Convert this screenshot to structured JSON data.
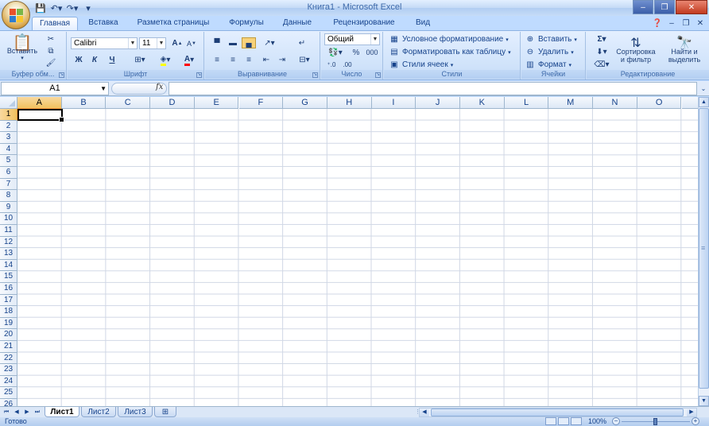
{
  "window": {
    "title": "Книга1 - Microsoft Excel"
  },
  "tabs": [
    "Главная",
    "Вставка",
    "Разметка страницы",
    "Формулы",
    "Данные",
    "Рецензирование",
    "Вид"
  ],
  "ribbon": {
    "clipboard": {
      "label": "Буфер обм...",
      "paste": "Вставить"
    },
    "font": {
      "label": "Шрифт",
      "name": "Calibri",
      "size": "11",
      "bold": "Ж",
      "italic": "К",
      "underline": "Ч"
    },
    "alignment": {
      "label": "Выравнивание"
    },
    "number": {
      "label": "Число",
      "format": "Общий",
      "percent": "%",
      "thousands": "000"
    },
    "styles": {
      "label": "Стили",
      "conditional": "Условное форматирование",
      "format_table": "Форматировать как таблицу",
      "cell_styles": "Стили ячеек"
    },
    "cells": {
      "label": "Ячейки",
      "insert": "Вставить",
      "delete": "Удалить",
      "format": "Формат"
    },
    "editing": {
      "label": "Редактирование",
      "sort_line1": "Сортировка",
      "sort_line2": "и фильтр",
      "find_line1": "Найти и",
      "find_line2": "выделить"
    }
  },
  "formula_bar": {
    "name_box": "A1",
    "fx": "fx",
    "value": ""
  },
  "grid": {
    "columns": [
      "A",
      "B",
      "C",
      "D",
      "E",
      "F",
      "G",
      "H",
      "I",
      "J",
      "K",
      "L",
      "M",
      "N",
      "O"
    ],
    "rows": [
      "1",
      "2",
      "3",
      "4",
      "5",
      "6",
      "7",
      "8",
      "9",
      "10",
      "11",
      "12",
      "13",
      "14",
      "15",
      "16",
      "17",
      "18",
      "19",
      "20",
      "21",
      "22",
      "23",
      "24",
      "25",
      "26"
    ],
    "selected_column": "A",
    "selected_row": "1"
  },
  "sheets": [
    "Лист1",
    "Лист2",
    "Лист3"
  ],
  "status": {
    "text": "Готово",
    "zoom": "100%",
    "zoom_level": 0.5
  },
  "colors": {
    "accent": "#15428b",
    "selection": "#f1c15f",
    "gridline": "#d0d7e5"
  }
}
